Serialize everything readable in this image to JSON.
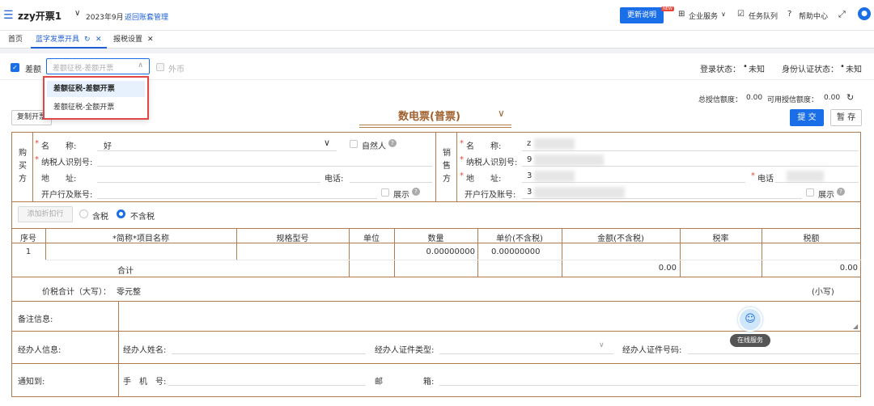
{
  "topbar": {
    "app_title": "zzy开票1",
    "period": "2023年9月",
    "back_link": "返回账套管理",
    "update_btn": "更新说明",
    "new_badge": "NEW",
    "enterprise": "企业服务",
    "tasks": "任务队列",
    "help": "帮助中心"
  },
  "tabs": [
    {
      "label": "首页"
    },
    {
      "label": "蓝字发票开具"
    },
    {
      "label": "报税设置"
    }
  ],
  "filter": {
    "diff_label": "差额",
    "select_placeholder": "差额征税-差额开票",
    "foreign_label": "外币",
    "options": [
      "差额征税-差额开票",
      "差额征税-全额开票"
    ],
    "login_status_label": "登录状态：",
    "login_status_value": "未知",
    "auth_status_label": "身份认证状态：",
    "auth_status_value": "未知"
  },
  "credit": {
    "total_label": "总授信额度：",
    "total_value": "0.00",
    "available_label": "可用授信额度：",
    "available_value": "0.00"
  },
  "actions": {
    "copy": "复制开票",
    "submit": "提 交",
    "save": "暂 存"
  },
  "invoice": {
    "title": "数电票(普票)"
  },
  "buyer": {
    "side_label": [
      "购",
      "买",
      "方"
    ],
    "name_label": "名　　称:",
    "name_value": "好",
    "natural_person": "自然人",
    "taxid_label": "纳税人识别号:",
    "address_label": "地　　址:",
    "phone_label": "电话:",
    "bank_label": "开户行及账号:",
    "show_label": "展示"
  },
  "seller": {
    "side_label": [
      "销",
      "售",
      "方"
    ],
    "name_label": "名　　称:",
    "name_value": "z",
    "taxid_label": "纳税人识别号:",
    "taxid_value": "9",
    "address_label": "地　　址:",
    "address_value": "3",
    "phone_label": "电话",
    "bank_label": "开户行及账号:",
    "bank_value": "3",
    "show_label": "展示"
  },
  "lines": {
    "add_discount": "添加折扣行",
    "tax_incl": "含税",
    "tax_excl": "不含税",
    "headers": [
      "序号",
      "*简称*项目名称",
      "规格型号",
      "单位",
      "数量",
      "单价(不含税)",
      "金额(不含税)",
      "税率",
      "税额"
    ],
    "row_index": "1",
    "row_qty": "0.00000000",
    "row_price": "0.00000000",
    "total_label": "合计",
    "total_amount": "0.00",
    "total_tax": "0.00",
    "sum_label": "价税合计（大写）：",
    "sum_value": "零元整",
    "sum_small": "(小写)"
  },
  "remarks": {
    "remark_label": "备注信息:",
    "agent_label": "经办人信息:",
    "agent_name": "经办人姓名:",
    "agent_id_type": "经办人证件类型:",
    "agent_id_no": "经办人证件号码:",
    "notify_label": "通知到:",
    "phone": "手　机　号:",
    "email_a": "邮",
    "email_b": "箱:"
  },
  "online_service": "在线服务"
}
